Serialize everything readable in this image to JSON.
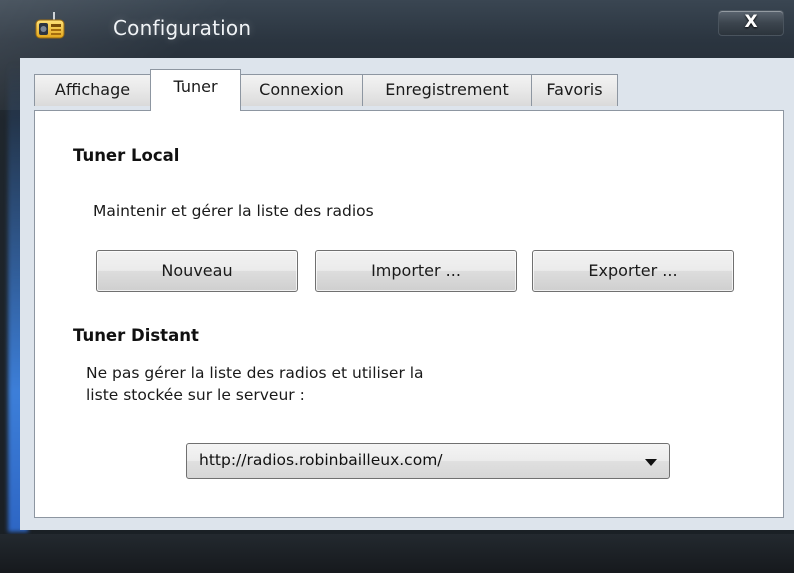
{
  "window": {
    "title": "Configuration",
    "close_label": "X",
    "icon": "radio-app-icon"
  },
  "tabs": [
    {
      "label": "Affichage",
      "active": false
    },
    {
      "label": "Tuner",
      "active": true
    },
    {
      "label": "Connexion",
      "active": false
    },
    {
      "label": "Enregistrement",
      "active": false
    },
    {
      "label": "Favoris",
      "active": false
    }
  ],
  "tuner_local": {
    "title": "Tuner Local",
    "description": "Maintenir et gérer la liste des radios",
    "buttons": {
      "new": "Nouveau",
      "import": "Importer ...",
      "export": "Exporter ..."
    }
  },
  "tuner_distant": {
    "title": "Tuner Distant",
    "description_line1": "Ne pas gérer la liste des radios et utiliser la",
    "description_line2": "liste stockée sur le serveur  :",
    "server_url": "http://radios.robinbailleux.com/"
  },
  "colors": {
    "frame": "#2b3540",
    "client_bg": "#dde4ec",
    "page_bg": "#ffffff",
    "accent_glow": "#3d7fd9"
  }
}
